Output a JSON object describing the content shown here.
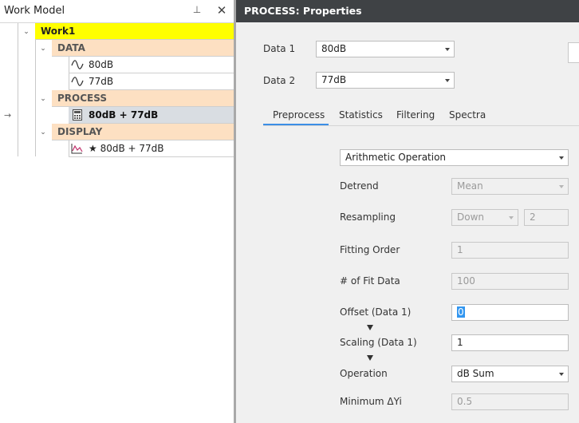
{
  "left_panel": {
    "title": "Work Model",
    "pin_glyph": "⊥",
    "close_glyph": "✕",
    "tree": {
      "root": "Work1",
      "data_label": "DATA",
      "data_items": [
        "80dB",
        "77dB"
      ],
      "process_label": "PROCESS",
      "process_items": [
        "80dB + 77dB"
      ],
      "display_label": "DISPLAY",
      "display_items": [
        "★ 80dB + 77dB"
      ]
    },
    "current_marker": "→"
  },
  "properties": {
    "title": "PROCESS: Properties",
    "data1_label": "Data 1",
    "data1_value": "80dB",
    "data2_label": "Data 2",
    "data2_value": "77dB",
    "tabs": [
      "Preprocess",
      "Statistics",
      "Filtering",
      "Spectra"
    ],
    "active_tab": "Preprocess",
    "operation_type": "Arithmetic Operation",
    "detrend_label": "Detrend",
    "detrend_value": "Mean",
    "resampling_label": "Resampling",
    "resampling_mode": "Down",
    "resampling_factor": "2",
    "fitting_order_label": "Fitting Order",
    "fitting_order_value": "1",
    "fit_data_label": "# of Fit Data",
    "fit_data_value": "100",
    "offset_label": "Offset (Data 1)",
    "offset_value": "0",
    "scaling_label": "Scaling (Data 1)",
    "scaling_value": "1",
    "operation_label": "Operation",
    "operation_value": "dB Sum",
    "min_dyi_label": "Minimum ΔYi",
    "min_dyi_value": "0.5"
  },
  "colors": {
    "root_highlight": "#ffff00",
    "group_bg": "#fde0c2",
    "header_dark": "#3f4245",
    "active_tab_underline": "#3c8ee6"
  }
}
